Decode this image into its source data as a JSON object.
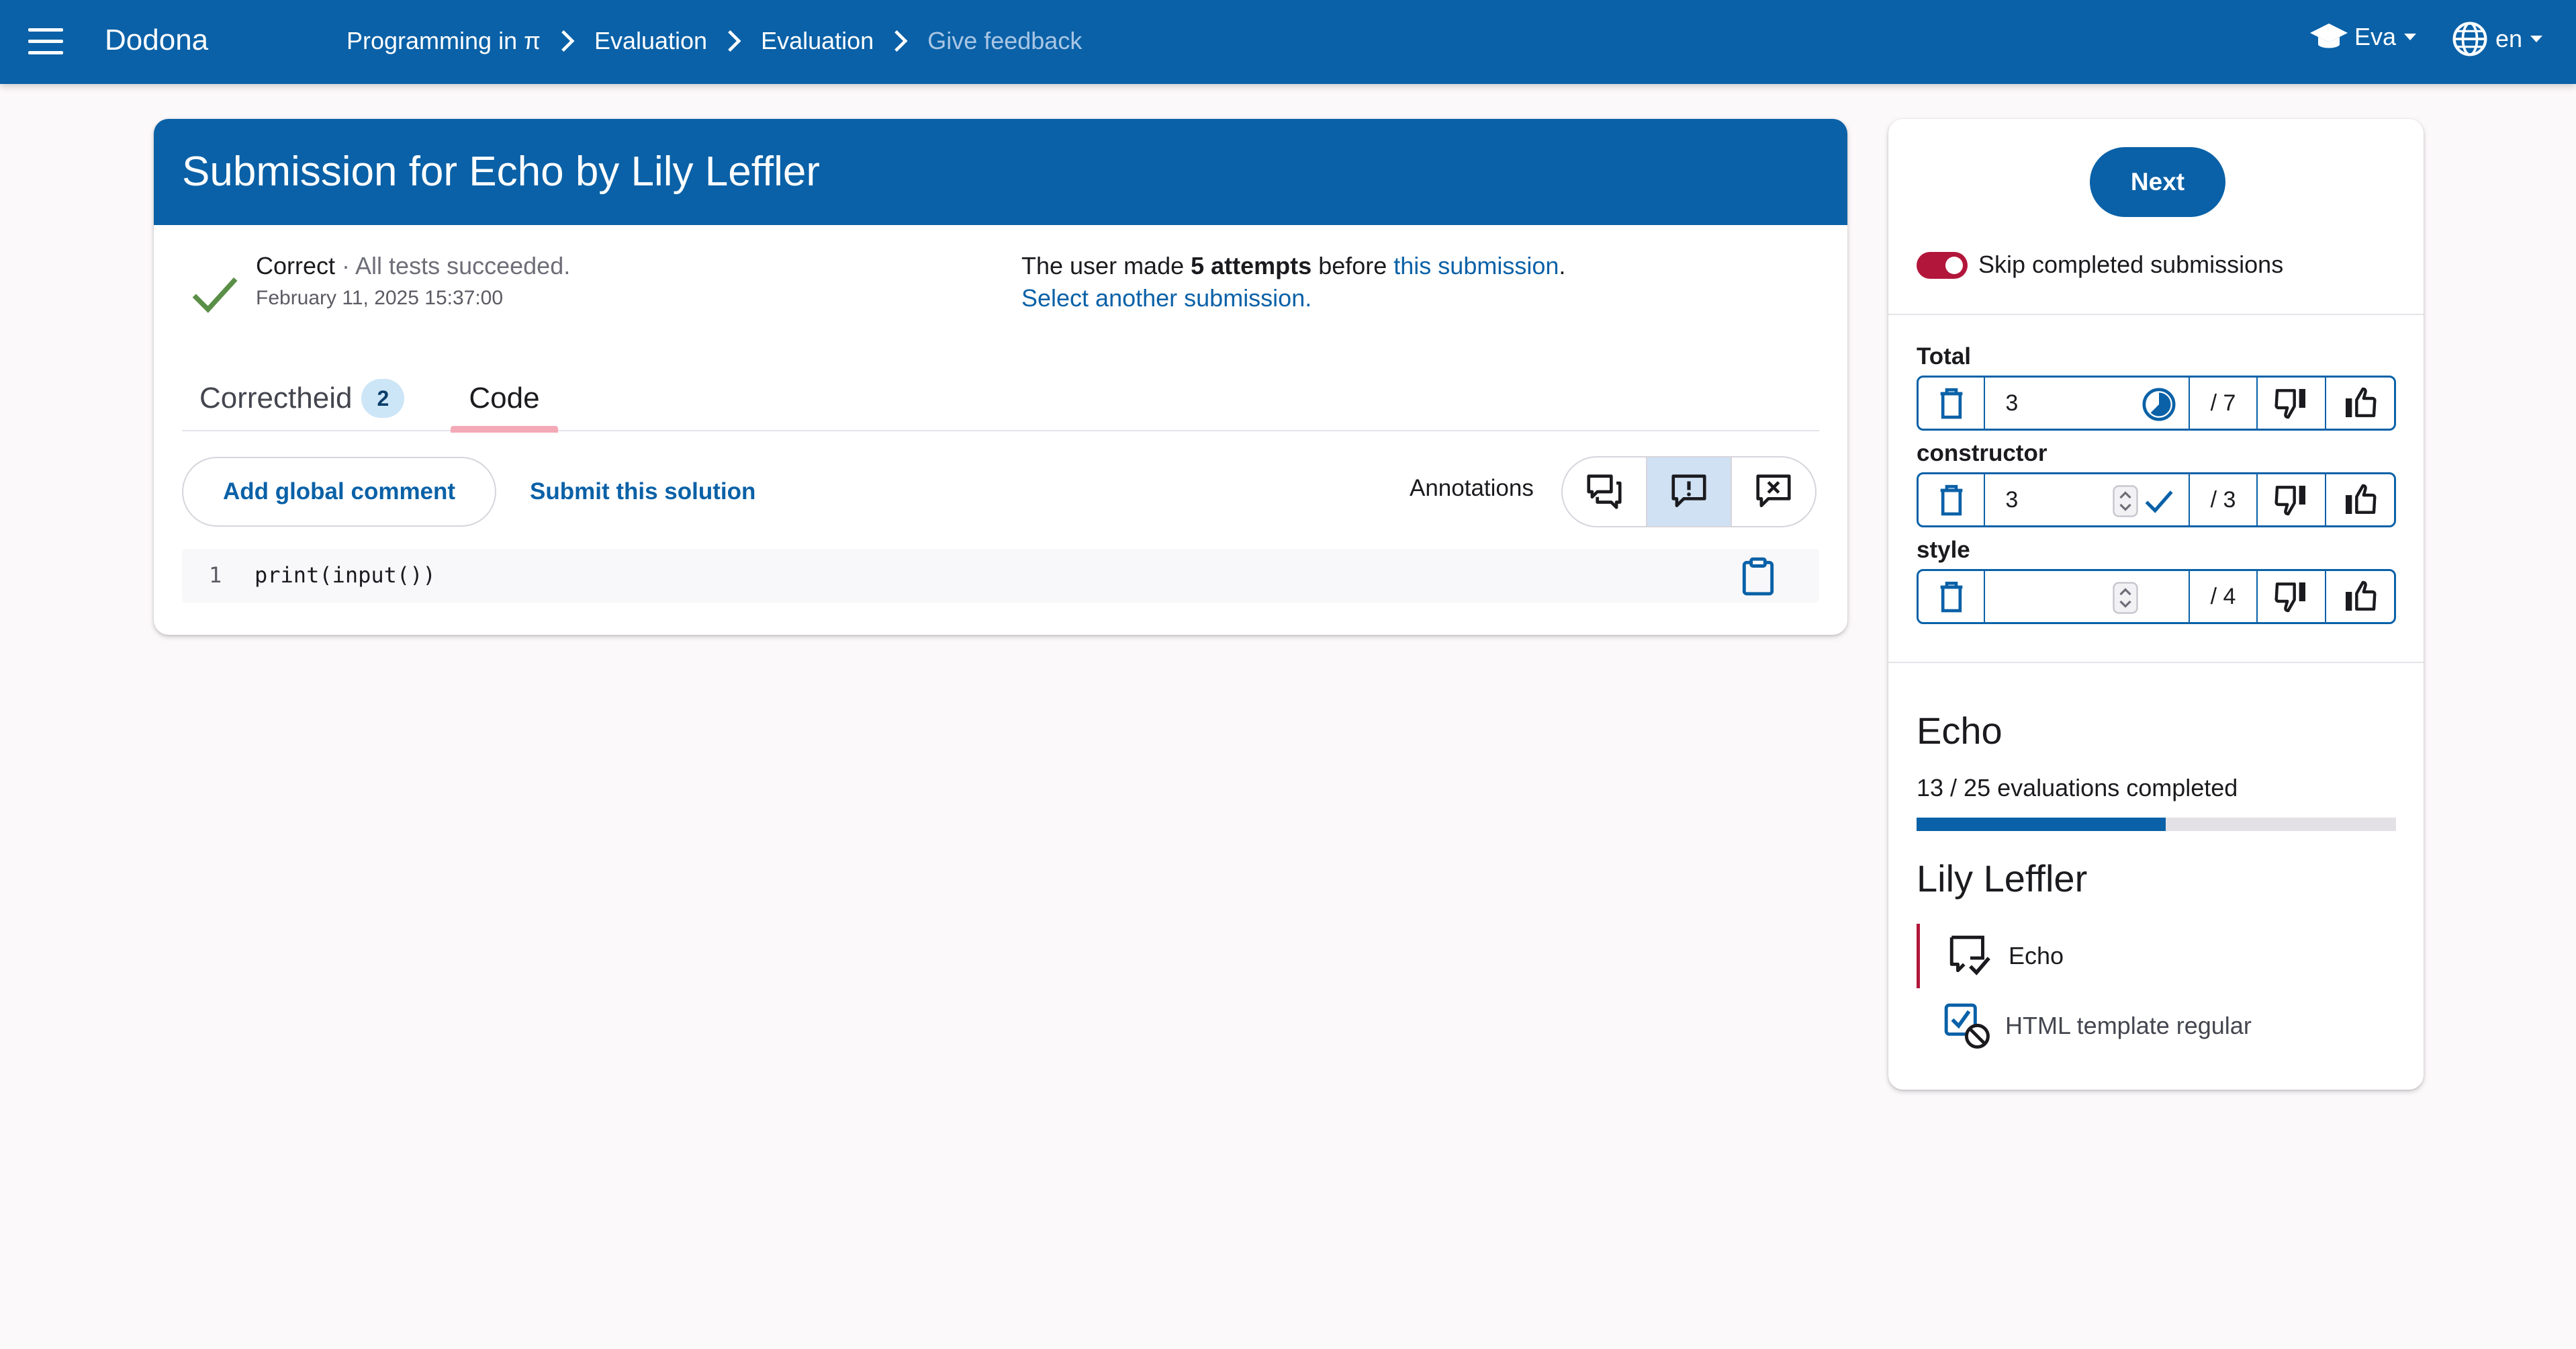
{
  "app": {
    "brand": "Dodona"
  },
  "breadcrumb": [
    {
      "label": "Programming in π"
    },
    {
      "label": "Evaluation"
    },
    {
      "label": "Evaluation"
    },
    {
      "label": "Give feedback"
    }
  ],
  "user_menu": {
    "name": "Eva"
  },
  "lang_menu": {
    "code": "en"
  },
  "submission": {
    "title": "Submission for Echo by Lily Leffler",
    "status": "Correct",
    "status_separator": " · ",
    "status_detail": "All tests succeeded.",
    "date": "February 11, 2025 15:37:00",
    "attempts_prefix": "The user made ",
    "attempts_count": "5 attempts",
    "attempts_middle": " before ",
    "attempts_link": "this submission",
    "attempts_suffix": ".",
    "select_another": "Select another submission."
  },
  "tabs": [
    {
      "label": "Correctheid",
      "badge": "2"
    },
    {
      "label": "Code"
    }
  ],
  "toolbar": {
    "add_global_comment": "Add global comment",
    "submit_solution": "Submit this solution",
    "annotations_label": "Annotations"
  },
  "code": {
    "line_number": "1",
    "line": "print(input())"
  },
  "side": {
    "next_label": "Next",
    "skip_label": "Skip completed submissions",
    "skip_enabled": true,
    "scores": [
      {
        "name": "Total",
        "value": "3",
        "max": "/ 7"
      },
      {
        "name": "constructor",
        "value": "3",
        "max": "/ 3"
      },
      {
        "name": "style",
        "value": "",
        "max": "/ 4"
      }
    ],
    "exercise_title": "Echo",
    "progress_text": "13 / 25 evaluations completed",
    "progress_fraction": 0.52,
    "student_name": "Lily Leffler",
    "student_exercises": [
      {
        "label": "Echo",
        "active": true
      },
      {
        "label": "HTML template regular",
        "active": false
      }
    ]
  },
  "colors": {
    "primary": "#0a61a7",
    "accent_red": "#b3163b",
    "success_green": "#5a8f47"
  }
}
